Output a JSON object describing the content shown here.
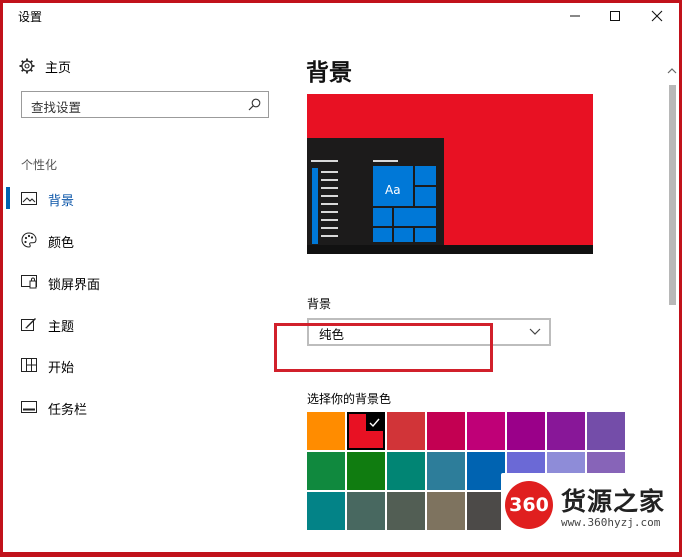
{
  "window": {
    "title": "设置",
    "minimize_glyph": "—",
    "close_glyph": "✕"
  },
  "sidebar": {
    "home_label": "主页",
    "search_placeholder": "查找设置",
    "section_title": "个性化",
    "items": [
      {
        "label": "背景",
        "icon": "image-icon",
        "active": true
      },
      {
        "label": "颜色",
        "icon": "palette-icon",
        "active": false
      },
      {
        "label": "锁屏界面",
        "icon": "lock-screen-icon",
        "active": false
      },
      {
        "label": "主题",
        "icon": "theme-icon",
        "active": false
      },
      {
        "label": "开始",
        "icon": "start-icon",
        "active": false
      },
      {
        "label": "任务栏",
        "icon": "taskbar-icon",
        "active": false
      }
    ]
  },
  "main": {
    "title": "背景",
    "preview": {
      "background_color": "#e81123",
      "tile_text": "Aa",
      "accent_color": "#0078d7"
    },
    "background_label": "背景",
    "background_value": "纯色",
    "swatch_label": "选择你的背景色",
    "swatches": [
      [
        "#ff8c00",
        "#e81123",
        "#d13438",
        "#c30052",
        "#bf0077",
        "#9a0089",
        "#881798",
        "#744da9"
      ],
      [
        "#10893e",
        "#107c10",
        "#018574",
        "#2d7d9a",
        "#0063b1",
        "#6b69d6",
        "#8e8cd8",
        "#8764b8"
      ],
      [
        "#038387",
        "#486860",
        "#525e54",
        "#7e735f",
        "#4c4a48",
        "#515c6b",
        "#4a5459",
        "#000000"
      ]
    ],
    "selected_swatch": "#e81123"
  },
  "watermark": {
    "badge": "360",
    "title": "货源之家",
    "url": "www.360hyzj.com"
  },
  "colors": {
    "accent": "#0063b1",
    "frame": "#c1121b",
    "highlight_box": "#d1202b"
  }
}
